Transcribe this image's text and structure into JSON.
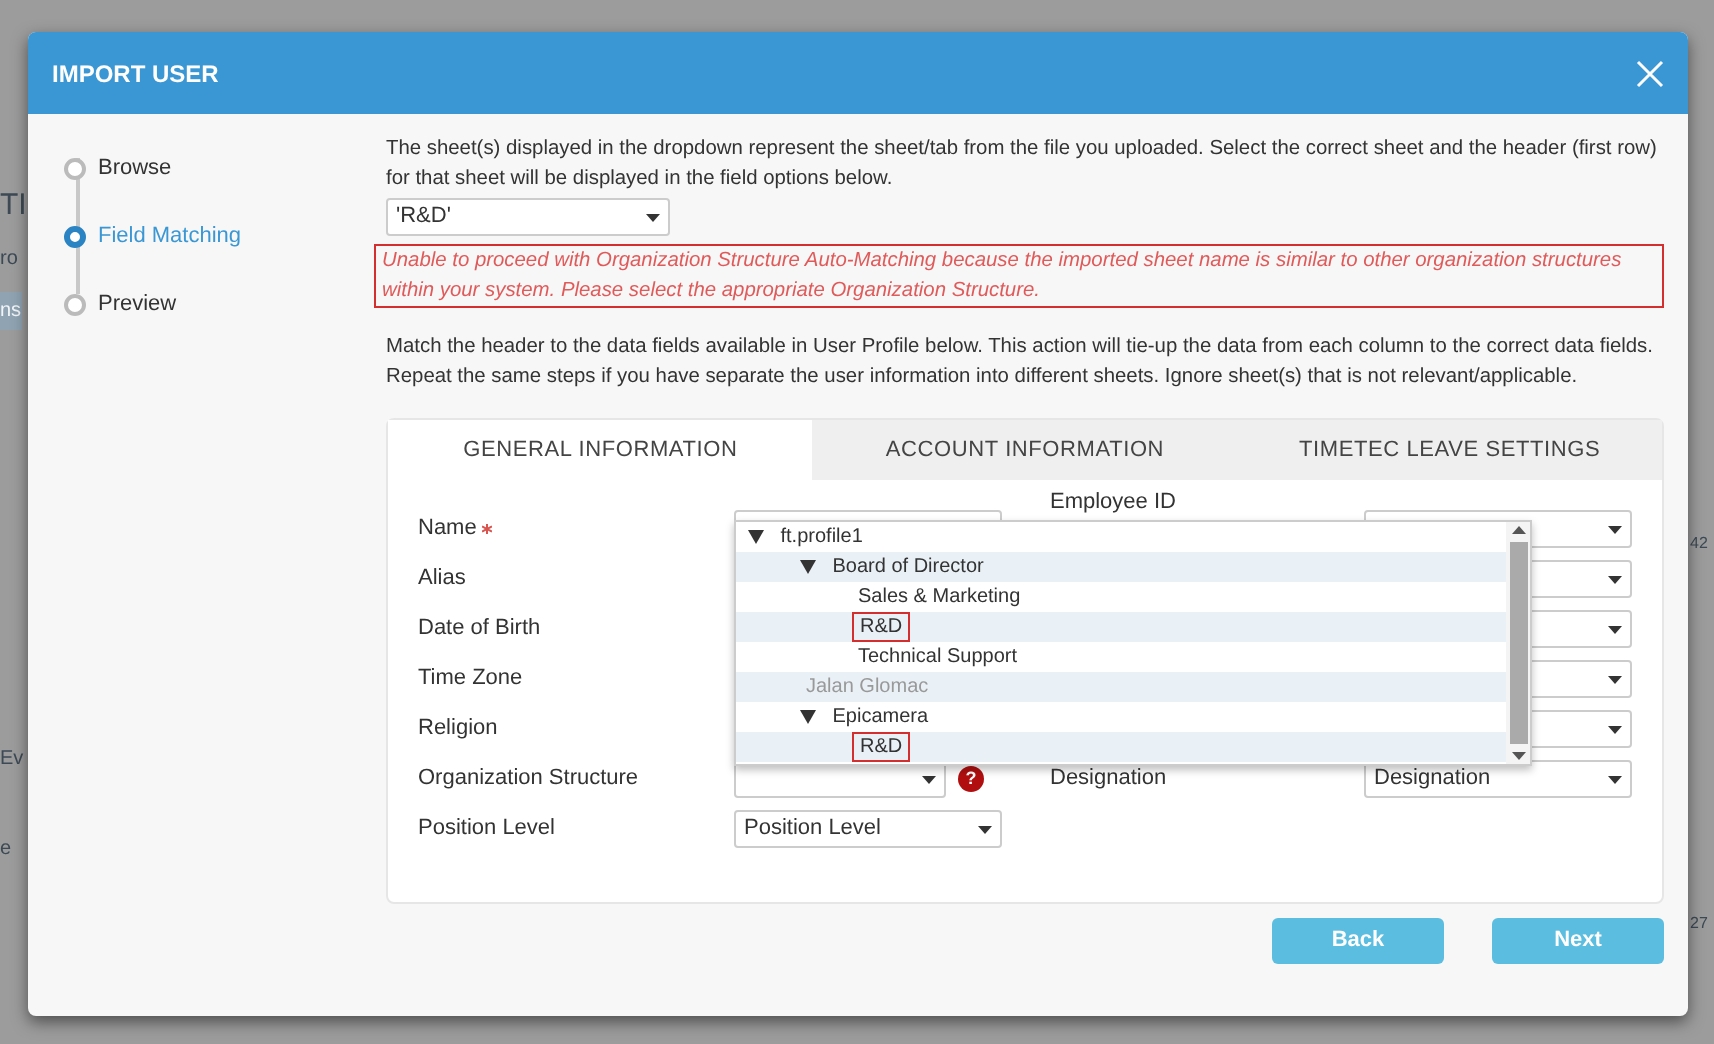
{
  "background_fragments": [
    "TI",
    "ro",
    "ns",
    "Ev",
    "e",
    "42",
    "27"
  ],
  "window": {
    "title": "IMPORT USER"
  },
  "steps": [
    {
      "label": "Browse",
      "selected": false
    },
    {
      "label": "Field Matching",
      "selected": true
    },
    {
      "label": "Preview",
      "selected": false
    }
  ],
  "intro": "The sheet(s) displayed in the dropdown represent the sheet/tab from the file you uploaded. Select the correct sheet and the header (first row) for that sheet will be displayed in the field options below.",
  "sheet_select": {
    "value": "'R&D'"
  },
  "error": "Unable to proceed with Organization Structure Auto-Matching because the imported sheet name is similar to other organization structures within your system. Please select the appropriate Organization Structure.",
  "instructions": "Match the header to the data fields available in User Profile below. This action will tie-up the data from each column to the correct data fields. Repeat the same steps if you have separate the user information into different sheets. Ignore sheet(s) that is not relevant/applicable.",
  "tabs": [
    {
      "label": "GENERAL INFORMATION",
      "selected": true
    },
    {
      "label": "ACCOUNT INFORMATION",
      "selected": false
    },
    {
      "label": "TIMETEC LEAVE SETTINGS",
      "selected": false
    }
  ],
  "fields_left": [
    {
      "kind": "select",
      "label": "Name",
      "required": true
    },
    {
      "kind": "label",
      "label": "Alias",
      "required": false
    },
    {
      "kind": "label",
      "label": "Date of Birth",
      "required": false
    },
    {
      "kind": "label",
      "label": "Time Zone",
      "required": false
    },
    {
      "kind": "label",
      "label": "Religion",
      "required": false
    },
    {
      "kind": "select",
      "label": "Organization Structure",
      "required": false,
      "help": "?"
    },
    {
      "kind": "select",
      "label": "Position Level",
      "required": false,
      "value": "Position Level"
    }
  ],
  "fields_right": [
    {
      "kind": "labelled",
      "label": "Employee ID"
    },
    {
      "kind": "select"
    },
    {
      "kind": "select"
    },
    {
      "kind": "select"
    },
    {
      "kind": "select"
    },
    {
      "kind": "labelled",
      "label": "Designation",
      "value": "Designation"
    }
  ],
  "org_tree": [
    {
      "label": "ft.profile1",
      "expanded": true,
      "children": [
        {
          "label": "Board of Director",
          "expanded": true,
          "children": [
            {
              "label": "Sales & Marketing",
              "highlighted": false
            },
            {
              "label": "R&D",
              "highlighted": true
            },
            {
              "label": "Technical Support",
              "highlighted": false
            }
          ]
        },
        {
          "label": "Jalan Glomac",
          "disabled": true
        },
        {
          "label": "Epicamera",
          "expanded": true,
          "children": [
            {
              "label": "R&D",
              "highlighted": true
            }
          ]
        }
      ]
    }
  ],
  "buttons": [
    "Back",
    "Next"
  ]
}
